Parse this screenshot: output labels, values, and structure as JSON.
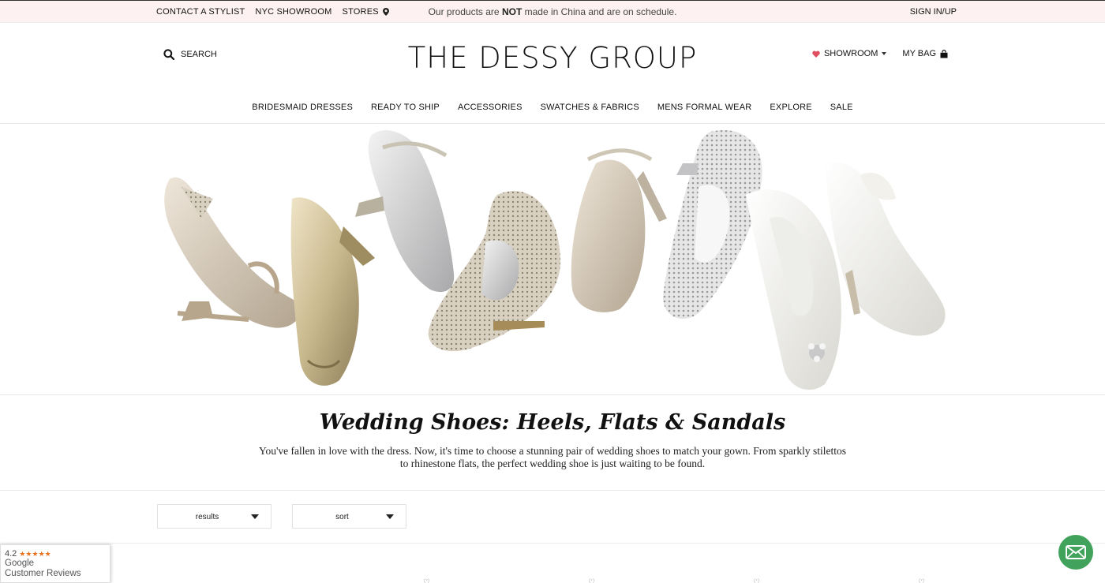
{
  "topbar": {
    "links": [
      "CONTACT A STYLIST",
      "NYC SHOWROOM",
      "STORES"
    ],
    "notice_before": "Our products are ",
    "notice_bold": "NOT",
    "notice_after": " made in China and are on schedule.",
    "signin": "SIGN IN/UP"
  },
  "header": {
    "search_label": "SEARCH",
    "logo": "THE DESSY GROUP",
    "showroom_label": "SHOWROOM",
    "bag_label": "MY BAG"
  },
  "nav": {
    "items": [
      "BRIDESMAID DRESSES",
      "READY TO SHIP",
      "ACCESSORIES",
      "SWATCHES & FABRICS",
      "MENS FORMAL WEAR",
      "EXPLORE",
      "SALE"
    ]
  },
  "category": {
    "title": "Wedding Shoes: Heels, Flats & Sandals",
    "description_line1": "You've fallen in love with the dress. Now, it's time to choose a stunning pair of wedding shoes to match your gown. From sparkly stilettos",
    "description_line2": "to rhinestone flats, the perfect wedding shoe is just waiting to be found."
  },
  "filters": {
    "results_label": "results",
    "sort_label": "sort"
  },
  "google_badge": {
    "rating": "4.2",
    "stars": "★★★★★",
    "line1": "Google",
    "line2": "Customer Reviews"
  },
  "colors": {
    "topbar_bg": "#fdf1f1",
    "heart": "#e04f5f",
    "chat": "#41a35b",
    "star": "#e7711b"
  },
  "icons": [
    "map-pin-icon",
    "search-icon",
    "heart-icon",
    "caret-down-icon",
    "shopping-bag-icon",
    "envelope-icon"
  ]
}
